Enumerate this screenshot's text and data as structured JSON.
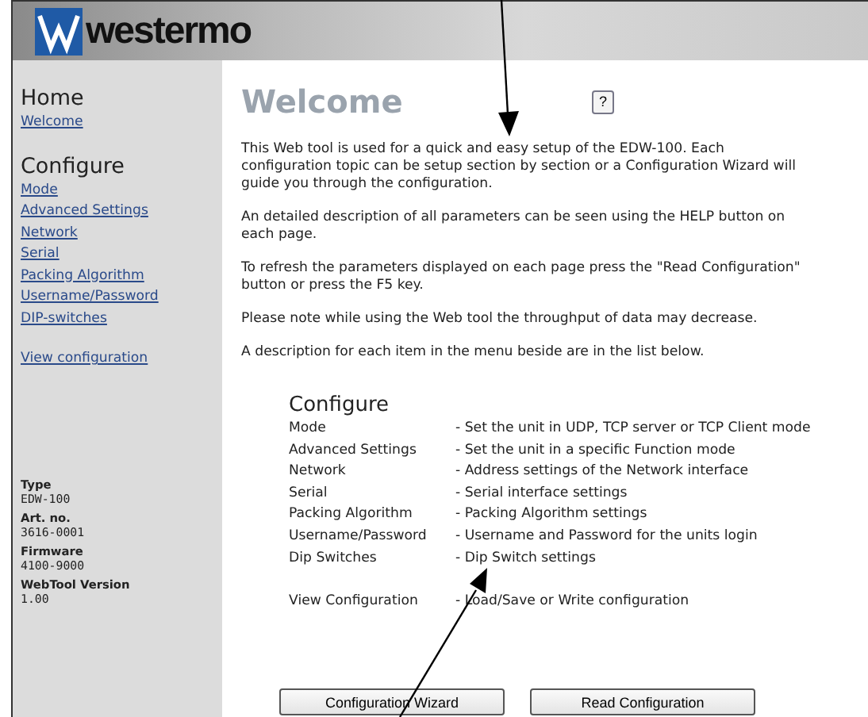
{
  "header": {
    "logo_text": "westermo"
  },
  "sidebar": {
    "sections": [
      {
        "title": "Home",
        "links": [
          "Welcome"
        ]
      },
      {
        "title": "Configure",
        "links": [
          "Mode",
          "Advanced Settings",
          "Network",
          "Serial",
          "Packing Algorithm",
          "Username/Password",
          "DIP-switches"
        ]
      },
      {
        "links": [
          "View configuration"
        ]
      }
    ],
    "info": [
      {
        "label": "Type",
        "value": "EDW-100"
      },
      {
        "label": "Art. no.",
        "value": "3616-0001"
      },
      {
        "label": "Firmware",
        "value": "4100-9000"
      },
      {
        "label": "WebTool Version",
        "value": "1.00"
      }
    ]
  },
  "content": {
    "title": "Welcome",
    "help_button": "?",
    "paragraphs": [
      "This Web tool is used for a quick and easy setup of the EDW-100. Each configuration topic can be setup section by section or a Configuration Wizard will guide you through the configuration.",
      "An detailed description of all parameters can be seen using the HELP button on each page.",
      "To refresh the parameters displayed on each page press the \"Read Configuration\" button or press the F5 key.",
      "Please note while using the Web tool the throughput of data may decrease.",
      "A description for each item in the menu beside are in the list below."
    ],
    "list_title": "Configure",
    "items": [
      {
        "name": "Mode",
        "description": "- Set the unit in UDP, TCP server or TCP Client mode"
      },
      {
        "name": "Advanced Settings",
        "description": "- Set the unit in a specific Function mode"
      },
      {
        "name": "Network",
        "description": "- Address settings of the Network interface"
      },
      {
        "name": "Serial",
        "description": "- Serial interface settings"
      },
      {
        "name": "Packing Algorithm",
        "description": "- Packing Algorithm settings"
      },
      {
        "name": "Username/Password",
        "description": "- Username and Password for the units login"
      },
      {
        "name": "Dip Switches",
        "description": "- Dip Switch settings"
      },
      {
        "name": "View Configuration",
        "description": "- Load/Save or Write configuration",
        "gap": true
      }
    ],
    "buttons": [
      "Configuration Wizard",
      "Read Configuration"
    ]
  }
}
